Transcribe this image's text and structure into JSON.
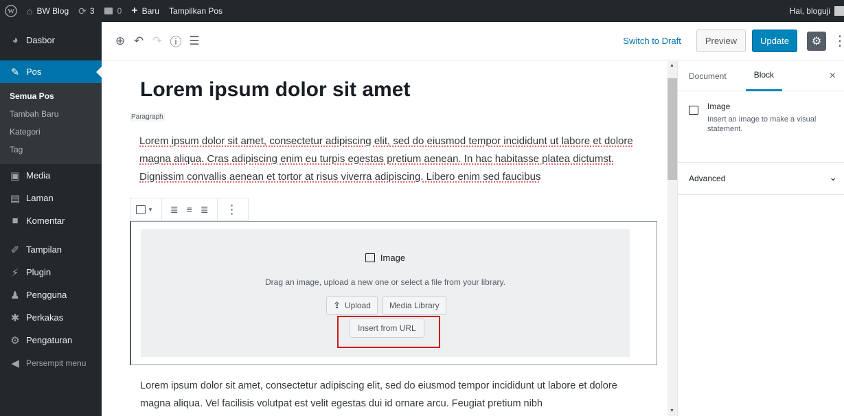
{
  "adminbar": {
    "site_name": "BW Blog",
    "updates_count": "3",
    "comments_count": "0",
    "new_label": "Baru",
    "view_post_label": "Tampilkan Pos",
    "greeting": "Hai, bloguji"
  },
  "sidebar": {
    "items": [
      {
        "label": "Dasbor",
        "icon": "dashboard-icon"
      },
      {
        "label": "Pos",
        "icon": "pin-icon"
      },
      {
        "label": "Media",
        "icon": "media-icon"
      },
      {
        "label": "Laman",
        "icon": "page-icon"
      },
      {
        "label": "Komentar",
        "icon": "comment-icon"
      },
      {
        "label": "Tampilan",
        "icon": "brush-icon"
      },
      {
        "label": "Plugin",
        "icon": "plugin-icon"
      },
      {
        "label": "Pengguna",
        "icon": "user-icon"
      },
      {
        "label": "Perkakas",
        "icon": "wrench-icon"
      },
      {
        "label": "Pengaturan",
        "icon": "settings-icon"
      },
      {
        "label": "Persempit menu",
        "icon": "collapse-icon"
      }
    ],
    "submenu": [
      "Semua Pos",
      "Tambah Baru",
      "Kategori",
      "Tag"
    ]
  },
  "header": {
    "switch_draft": "Switch to Draft",
    "preview": "Preview",
    "update": "Update"
  },
  "post": {
    "title": "Lorem ipsum dolor sit amet",
    "block_label": "Paragraph",
    "paragraph1": " Lorem ipsum dolor sit amet, consectetur adipiscing elit, sed do eiusmod tempor incididunt ut labore et dolore magna aliqua. Cras adipiscing enim eu turpis egestas pretium aenean. In hac habitasse platea dictumst. Dignissim convallis aenean et tortor at risus viverra adipiscing. Libero enim sed faucibus",
    "paragraph2": "Lorem ipsum dolor sit amet, consectetur adipiscing elit, sed do eiusmod tempor incididunt ut labore et dolore magna aliqua. Vel facilisis volutpat est velit egestas dui id ornare arcu. Feugiat pretium nibh"
  },
  "image_block": {
    "title": "Image",
    "description": "Drag an image, upload a new one or select a file from your library.",
    "upload": "Upload",
    "media_library": "Media Library",
    "insert_url": "Insert from URL"
  },
  "settings": {
    "tab_document": "Document",
    "tab_block": "Block",
    "block_name": "Image",
    "block_description": "Insert an image to make a visual statement.",
    "advanced": "Advanced"
  },
  "colors": {
    "admin_dark": "#23282d",
    "primary": "#0085ba",
    "highlight": "#cc1b1b"
  }
}
